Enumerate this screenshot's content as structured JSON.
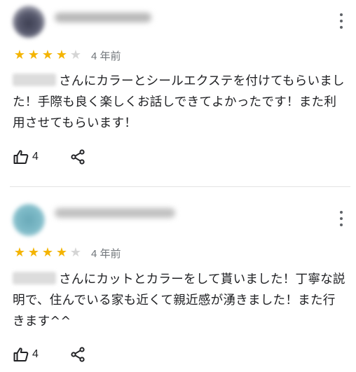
{
  "reviews": [
    {
      "rating": 4,
      "max_rating": 5,
      "time_ago": "4 年前",
      "text": "さんにカラーとシールエクステを付けてもらいました！手際も良く楽しくお話しできてよかったです！また利用させてもらいます！",
      "likes": "4",
      "avatar_color": "#4a4c60"
    },
    {
      "rating": 4,
      "max_rating": 5,
      "time_ago": "4 年前",
      "text": "さんにカットとカラーをして貰いました！丁寧な説明で、住んでいる家も近くて親近感が湧きました！また行きます^^",
      "likes": "4",
      "avatar_color": "#7bb7c4"
    }
  ],
  "colors": {
    "star": "#f4b400",
    "star_empty": "#d5d5d5",
    "secondary_text": "#70757a",
    "icon": "#202124"
  },
  "icons": {
    "menu": "more-vert-icon",
    "like": "thumb-up-icon",
    "share": "share-icon"
  }
}
